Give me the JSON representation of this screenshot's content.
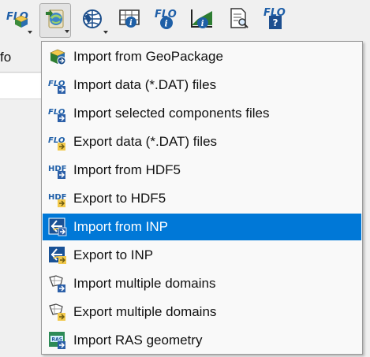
{
  "toolbar": {
    "buttons": [
      {
        "icon": "flo-gpkg-icon"
      },
      {
        "icon": "import-export-icon",
        "active": true
      },
      {
        "icon": "globe-icon"
      },
      {
        "icon": "map-info-icon"
      },
      {
        "icon": "flo-info-icon"
      },
      {
        "icon": "profile-info-icon"
      },
      {
        "icon": "document-search-icon"
      },
      {
        "icon": "flo-help-icon"
      }
    ]
  },
  "left_panel": {
    "tab_label": "fo"
  },
  "menu": {
    "items": [
      {
        "label": "Import from GeoPackage",
        "icon": "geopackage-icon"
      },
      {
        "label": "Import data (*.DAT) files",
        "icon": "flo-import-icon"
      },
      {
        "label": "Import selected components files",
        "icon": "flo-import-icon"
      },
      {
        "label": "Export data (*.DAT) files",
        "icon": "flo-export-icon"
      },
      {
        "label": "Import from HDF5",
        "icon": "hdf-import-icon"
      },
      {
        "label": "Export to HDF5",
        "icon": "hdf-export-icon"
      },
      {
        "label": "Import from INP",
        "icon": "inp-import-icon",
        "selected": true
      },
      {
        "label": "Export to INP",
        "icon": "inp-export-icon"
      },
      {
        "label": "Import multiple domains",
        "icon": "domains-import-icon"
      },
      {
        "label": "Export multiple domains",
        "icon": "domains-export-icon"
      },
      {
        "label": "Import RAS geometry",
        "icon": "ras-import-icon"
      }
    ]
  },
  "colors": {
    "selection": "#0078d7",
    "menu_bg": "#f9f9f9",
    "toolbar_bg": "#f0f0f0"
  }
}
